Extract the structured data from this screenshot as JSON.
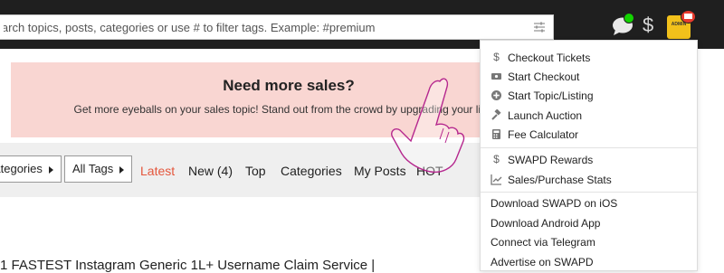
{
  "search": {
    "placeholder": "Search topics, posts, categories or use # to filter tags. Example: #premium"
  },
  "header": {
    "avatar_text": "ADMIN"
  },
  "banner": {
    "title": "Need more sales?",
    "text": "Get more eyeballs on your sales topic! Stand out from the crowd by upgrading your listing"
  },
  "nav": {
    "categories_dropdown": "Categories",
    "tags_dropdown": "All Tags",
    "links": [
      "Latest",
      "New (4)",
      "Top",
      "Categories",
      "My Posts",
      "HOT"
    ]
  },
  "topic": {
    "title": "1 FASTEST Instagram Generic 1L+ Username Claim Service |"
  },
  "menu": {
    "group1": [
      {
        "icon": "dollar-icon",
        "label": "Checkout Tickets"
      },
      {
        "icon": "ticket-icon",
        "label": "Start Checkout"
      },
      {
        "icon": "plus-circle-icon",
        "label": "Start Topic/Listing"
      },
      {
        "icon": "gavel-icon",
        "label": "Launch Auction"
      },
      {
        "icon": "calculator-icon",
        "label": "Fee Calculator"
      }
    ],
    "group2": [
      {
        "icon": "dollar-icon",
        "label": "SWAPD Rewards"
      },
      {
        "icon": "chart-line-icon",
        "label": "Sales/Purchase Stats"
      }
    ],
    "group3": [
      {
        "label": "Download SWAPD on iOS"
      },
      {
        "label": "Download Android App"
      },
      {
        "label": "Connect via Telegram"
      },
      {
        "label": "Advertise on SWAPD"
      }
    ]
  },
  "colors": {
    "accent": "#e4563c",
    "header_bg": "#1f1f1f",
    "banner_bg": "#f9d6d2",
    "online": "#12d300",
    "notify": "#e63b2e"
  }
}
